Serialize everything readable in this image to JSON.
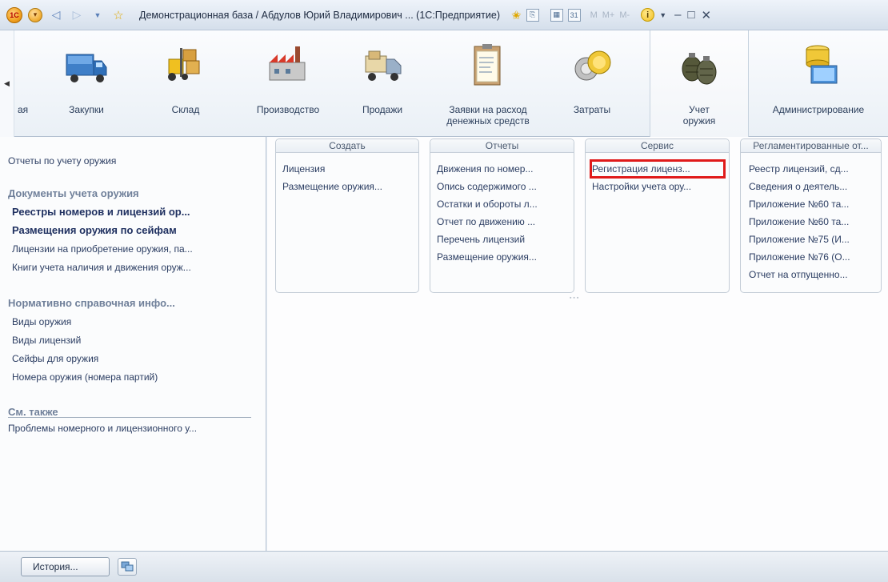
{
  "window": {
    "title": "Демонстрационная база / Абдулов Юрий Владимирович ...  (1С:Предприятие)",
    "app_logo": "1С",
    "tool_labels": [
      "M",
      "M+",
      "M-"
    ]
  },
  "sections": {
    "items": [
      {
        "label": "ая",
        "icon": "partial-section-icon"
      },
      {
        "label": "Закупки",
        "icon": "truck-icon"
      },
      {
        "label": "Склад",
        "icon": "forklift-icon"
      },
      {
        "label": "Производство",
        "icon": "factory-icon"
      },
      {
        "label": "Продажи",
        "icon": "delivery-van-icon"
      },
      {
        "label": "Заявки на расход\nденежных средств",
        "icon": "clipboard-icon"
      },
      {
        "label": "Затраты",
        "icon": "coins-icon"
      },
      {
        "label": "Учет\nоружия",
        "icon": "grenades-icon",
        "active": true
      },
      {
        "label": "Администрирование",
        "icon": "database-computer-icon"
      }
    ]
  },
  "left_panel": {
    "top_link": "Отчеты по учету оружия",
    "documents_header": "Документы учета оружия",
    "documents": [
      {
        "label": "Реестры номеров и лицензий ор...",
        "bold": true
      },
      {
        "label": "Размещения оружия по сейфам",
        "bold": true
      },
      {
        "label": "Лицензии на приобретение оружия, па...",
        "bold": false
      },
      {
        "label": "Книги учета наличия и движения оруж...",
        "bold": false
      }
    ],
    "reference_header": "Нормативно справочная инфо...",
    "reference": [
      "Виды оружия",
      "Виды лицензий",
      "Сейфы для оружия",
      "Номера оружия (номера партий)"
    ],
    "see_also_header": "См. также",
    "see_also": [
      "Проблемы номерного и лицензионного у..."
    ]
  },
  "groups": {
    "create": {
      "title": "Создать",
      "items": [
        "Лицензия",
        "Размещение оружия..."
      ]
    },
    "reports": {
      "title": "Отчеты",
      "items": [
        "Движения по номер...",
        "Опись содержимого ...",
        "Остатки и обороты л...",
        "Отчет по движению ...",
        "Перечень лицензий",
        "Размещение оружия..."
      ]
    },
    "service": {
      "title": "Сервис",
      "items": [
        "Регистрация лиценз...",
        "Настройки учета ору..."
      ],
      "highlighted_index": 0
    },
    "regulated": {
      "title": "Регламентированные от...",
      "items": [
        "Реестр лицензий, сд...",
        "Сведения о деятель...",
        "Приложение №60 та...",
        "Приложение №60 та...",
        "Приложение №75 (И...",
        "Приложение №76 (О...",
        "Отчет на отпущенно..."
      ]
    }
  },
  "bottom": {
    "history_button": "История..."
  },
  "colors": {
    "highlight": "#e01a1a",
    "link": "#2b3d62",
    "header_gray": "#70809a"
  }
}
